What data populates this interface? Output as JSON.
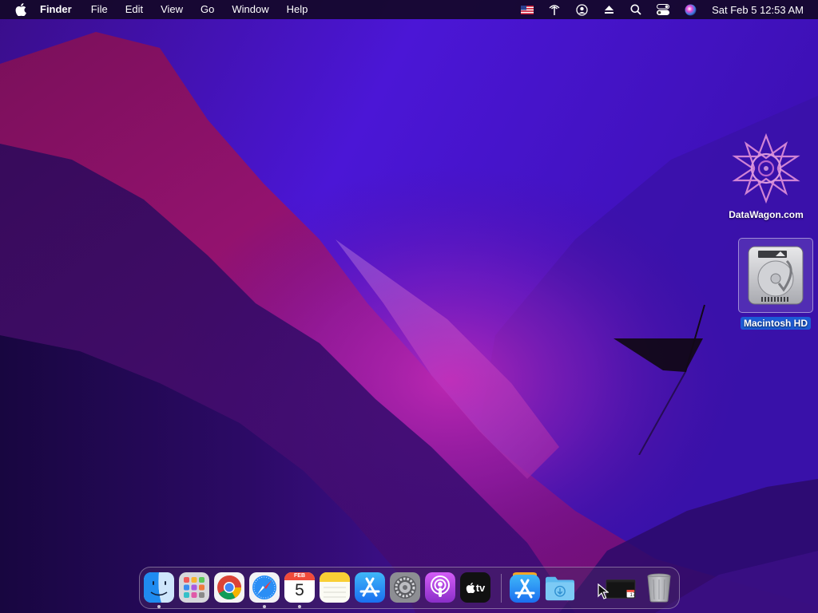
{
  "menubar": {
    "app_name": "Finder",
    "menus": [
      "File",
      "Edit",
      "View",
      "Go",
      "Window",
      "Help"
    ],
    "clock": "Sat Feb 5  12:53 AM",
    "status_icons": [
      "us-flag-icon",
      "antenna-icon",
      "user-circle-icon",
      "eject-icon",
      "search-icon",
      "control-center-icon",
      "siri-icon"
    ]
  },
  "desktop": {
    "icons": [
      {
        "label": "DataWagon.com",
        "icon": "datawagon-star-icon"
      },
      {
        "label": "Macintosh HD",
        "icon": "hard-drive-icon",
        "selected": true
      }
    ]
  },
  "dock": {
    "calendar": {
      "month": "FEB",
      "day": "5"
    },
    "tv_label": "tv",
    "mini_calendar_day": "17",
    "items": [
      "finder",
      "launchpad",
      "chrome",
      "safari",
      "calendar",
      "notes",
      "app-store",
      "system-preferences",
      "podcasts",
      "apple-tv",
      "app-store-downloads",
      "downloads-folder",
      "screen-thumbnail",
      "trash"
    ]
  },
  "colors": {
    "selection_blue": "#1d5bd6",
    "wallpaper_violet": "#5a1bd0",
    "wallpaper_magenta": "#c4148a"
  }
}
